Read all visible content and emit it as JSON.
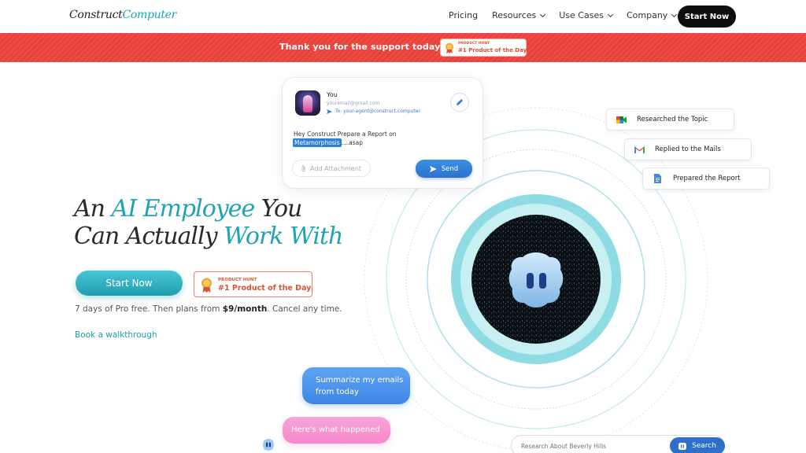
{
  "nav": {
    "logo_part1": "Construct",
    "logo_part2": "Computer",
    "links": [
      "Pricing",
      "Resources",
      "Use Cases",
      "Company"
    ],
    "cta": "Start Now"
  },
  "banner": {
    "text": "Thank you for the support today",
    "badge_kicker": "PRODUCT HUNT",
    "badge_title": "#1 Product of the Day"
  },
  "email_card": {
    "from_name": "You",
    "from_email": "youremail@gmail.com",
    "to": "To: your-agent@construct.computer",
    "message_line1": "Hey Construct Prepare a Report on",
    "message_highlight": "Metamorphosis",
    "message_tail": "....asap",
    "attach_label": "Add Attachment",
    "send_label": "Send"
  },
  "tasks": [
    {
      "label": "Researched the Topic",
      "icon": "google-meet-icon"
    },
    {
      "label": "Replied to the Mails",
      "icon": "gmail-icon"
    },
    {
      "label": "Prepared the Report",
      "icon": "google-docs-icon"
    }
  ],
  "hero": {
    "w1": "An ",
    "w2": "AI Employee",
    "w3": " You",
    "w4": "Can Actually ",
    "w5": "Work With",
    "cta": "Start Now",
    "badge_kicker": "PRODUCT HUNT",
    "badge_title": "#1 Product of the Day",
    "pro_pre": "7 days of Pro free. Then plans from ",
    "pro_price": "$9/month",
    "pro_post": ". Cancel any time.",
    "walkthrough": "Book a walkthrough"
  },
  "chat": {
    "user_line1": "Summarize my emails",
    "user_line2": "from today",
    "reply": "Here's what happened"
  },
  "search": {
    "placeholder": "Research About Beverly Hills",
    "button": "Search"
  },
  "colors": {
    "accent": "#1fa3b5",
    "banner_red": "#f04a43",
    "send_blue": "#2a73cf",
    "badge_orange": "#d8542f"
  }
}
